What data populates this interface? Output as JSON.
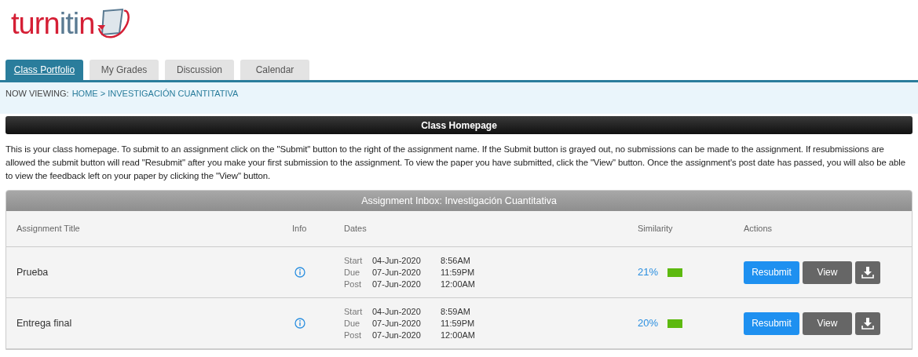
{
  "logo": {
    "parts": [
      {
        "text": "turn",
        "color": "#d51f35"
      },
      {
        "text": "iti",
        "color": "#5a7a92"
      },
      {
        "text": "n",
        "color": "#d51f35"
      }
    ]
  },
  "tabs": [
    {
      "label": "Class Portfolio",
      "selected": true
    },
    {
      "label": "My Grades",
      "selected": false
    },
    {
      "label": "Discussion",
      "selected": false
    },
    {
      "label": "Calendar",
      "selected": false
    }
  ],
  "breadcrumb": {
    "prefix": "NOW VIEWING:",
    "path": "HOME > INVESTIGACIÓN CUANTITATIVA"
  },
  "page_header": "Class Homepage",
  "intro": "This is your class homepage. To submit to an assignment click on the \"Submit\" button to the right of the assignment name. If the Submit button is grayed out, no submissions can be made to the assignment. If resubmissions are allowed the submit button will read \"Resubmit\" after you make your first submission to the assignment. To view the paper you have submitted, click the \"View\" button. Once the assignment's post date has passed, you will also be able to view the feedback left on your paper by clicking the \"View\" button.",
  "inbox": {
    "title": "Assignment Inbox: Investigación Cuantitativa",
    "columns": [
      "Assignment Title",
      "Info",
      "Dates",
      "Similarity",
      "Actions"
    ],
    "rows": [
      {
        "title": "Prueba",
        "dates": [
          {
            "label": "Start",
            "date": "04-Jun-2020",
            "time": "8:56AM"
          },
          {
            "label": "Due",
            "date": "07-Jun-2020",
            "time": "11:59PM"
          },
          {
            "label": "Post",
            "date": "07-Jun-2020",
            "time": "12:00AM"
          }
        ],
        "similarity": "21%",
        "color": "#5db90f",
        "actions": [
          "Resubmit",
          "View"
        ]
      },
      {
        "title": "Entrega final",
        "dates": [
          {
            "label": "Start",
            "date": "04-Jun-2020",
            "time": "8:59AM"
          },
          {
            "label": "Due",
            "date": "07-Jun-2020",
            "time": "11:59PM"
          },
          {
            "label": "Post",
            "date": "07-Jun-2020",
            "time": "12:00AM"
          }
        ],
        "similarity": "20%",
        "color": "#5db90f",
        "actions": [
          "Resubmit",
          "View"
        ]
      }
    ]
  }
}
